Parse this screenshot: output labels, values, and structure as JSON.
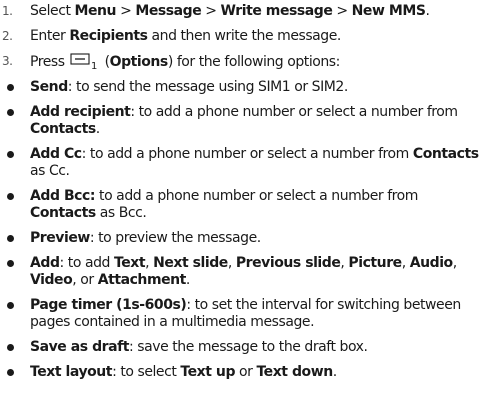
{
  "steps": [
    {
      "num": "1.",
      "t1": "Select ",
      "b1": "Menu",
      "t2": " > ",
      "b2": "Message",
      "t3": " > ",
      "b3": "Write message",
      "t4": " > ",
      "b4": "New MMS",
      "t5": "."
    },
    {
      "num": "2.",
      "t1": "Enter ",
      "b1": "Recipients",
      "t2": " and then write the message."
    },
    {
      "num": "3.",
      "t1": "Press ",
      "icon": "options-softkey-icon",
      "icon_sub": "1",
      "t2": " (",
      "b1": "Options",
      "t3": ") for the following options:"
    }
  ],
  "options": [
    {
      "b1": "Send",
      "t1": ": to send the message using SIM1 or SIM2."
    },
    {
      "b1": "Add recipient",
      "t1": ": to add a phone number or select a number from ",
      "b2": "Contacts",
      "t2": "."
    },
    {
      "b1": "Add Cc",
      "t1": ": to add a phone number or select a number from ",
      "b2": "Contacts",
      "t2": " as Cc."
    },
    {
      "b1": "Add Bcc:",
      "t1": " to add a phone number or select a number from ",
      "b2": "Contacts",
      "t2": " as Bcc."
    },
    {
      "b1": "Preview",
      "t1": ": to preview the message."
    },
    {
      "b1": "Add",
      "t1": ": to add ",
      "b2": "Text",
      "t2": ", ",
      "b3": "Next slide",
      "t3": ", ",
      "b4": "Previous slide",
      "t4": ", ",
      "b5": "Picture",
      "t5": ", ",
      "b6": "Audio",
      "t6": ", ",
      "b7": "Video",
      "t7": ", or ",
      "b8": "Attachment",
      "t8": "."
    },
    {
      "b1": "Page timer (1s-600s)",
      "t1": ": to set the interval for switching between pages contained in a multimedia message."
    },
    {
      "b1": "Save as draft",
      "t1": ": save the message to the draft box."
    },
    {
      "b1": "Text layout",
      "t1": ": to select ",
      "b2": "Text up",
      "t2": " or ",
      "b3": "Text down",
      "t3": "."
    }
  ]
}
